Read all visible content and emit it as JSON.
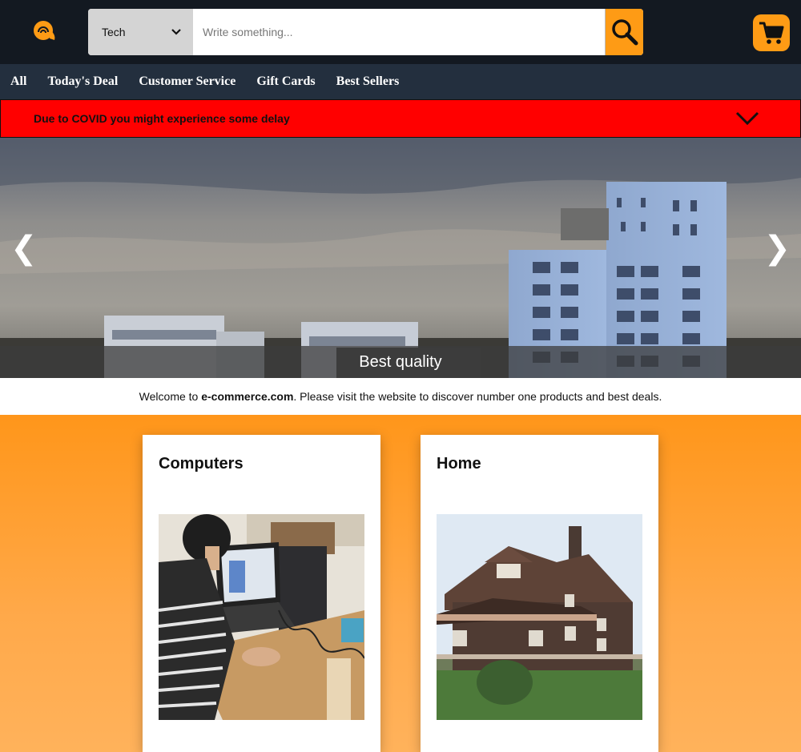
{
  "search": {
    "category": "Tech",
    "placeholder": "Write something..."
  },
  "nav": {
    "items": [
      "All",
      "Today's Deal",
      "Customer Service",
      "Gift Cards",
      "Best Sellers"
    ]
  },
  "banner": {
    "text": "Due to COVID you might experience some delay"
  },
  "hero": {
    "caption": "Best quality",
    "prev": "❮",
    "next": "❯"
  },
  "welcome": {
    "prefix": "Welcome to ",
    "site": "e-commerce.com",
    "suffix": ". Please visit the website to discover number one products and best deals."
  },
  "cards": [
    {
      "title": "Computers"
    },
    {
      "title": "Home"
    }
  ],
  "colors": {
    "header": "#131921",
    "nav": "#232f3e",
    "accent": "#fe9b15",
    "banner": "#ff0000"
  },
  "icons": [
    "logo-icon",
    "chevron-down-icon",
    "search-icon",
    "cart-icon"
  ]
}
